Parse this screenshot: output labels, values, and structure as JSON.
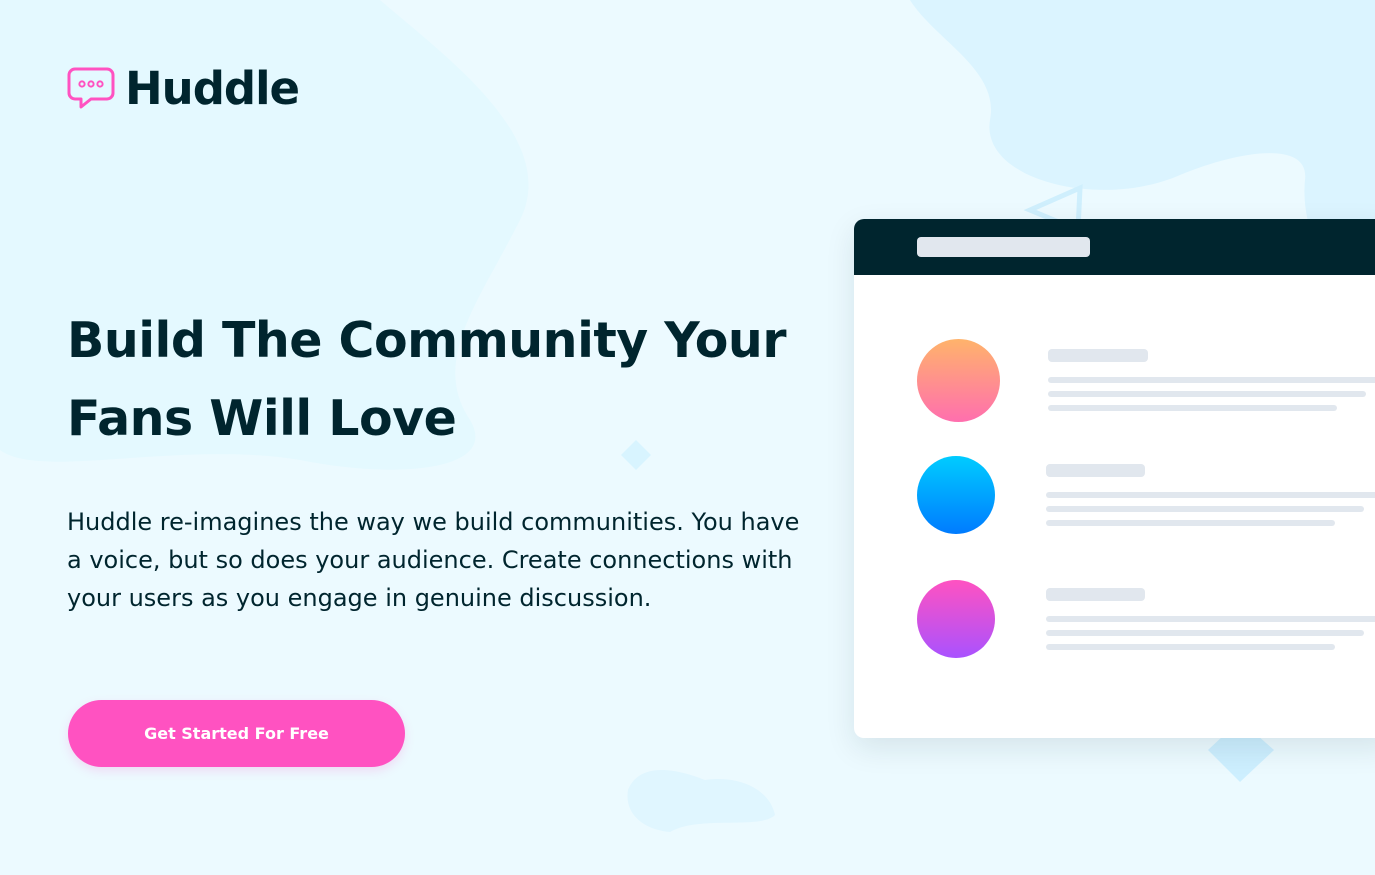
{
  "brand": {
    "name": "Huddle",
    "logo_icon": "chat-bubble-icon",
    "accent_color": "#ff52c1"
  },
  "hero": {
    "headline": "Build The Community Your Fans Will Love",
    "description": "Huddle re-imagines the way we build communities. You have a voice, but so does your audience. Create connections with your users as you engage in genuine discussion.",
    "cta_label": "Get Started For Free"
  },
  "colors": {
    "background": "#ecfaff",
    "text": "#00252e",
    "cta": "#ff52c1",
    "mockup_bar": "#00252e",
    "placeholder": "#e1e7ee"
  },
  "mockup": {
    "avatars": [
      {
        "gradient": [
          "#ffb36b",
          "#ff6fae"
        ]
      },
      {
        "gradient": [
          "#00ccff",
          "#007bff"
        ]
      },
      {
        "gradient": [
          "#ff52c1",
          "#a952ff"
        ]
      }
    ]
  }
}
